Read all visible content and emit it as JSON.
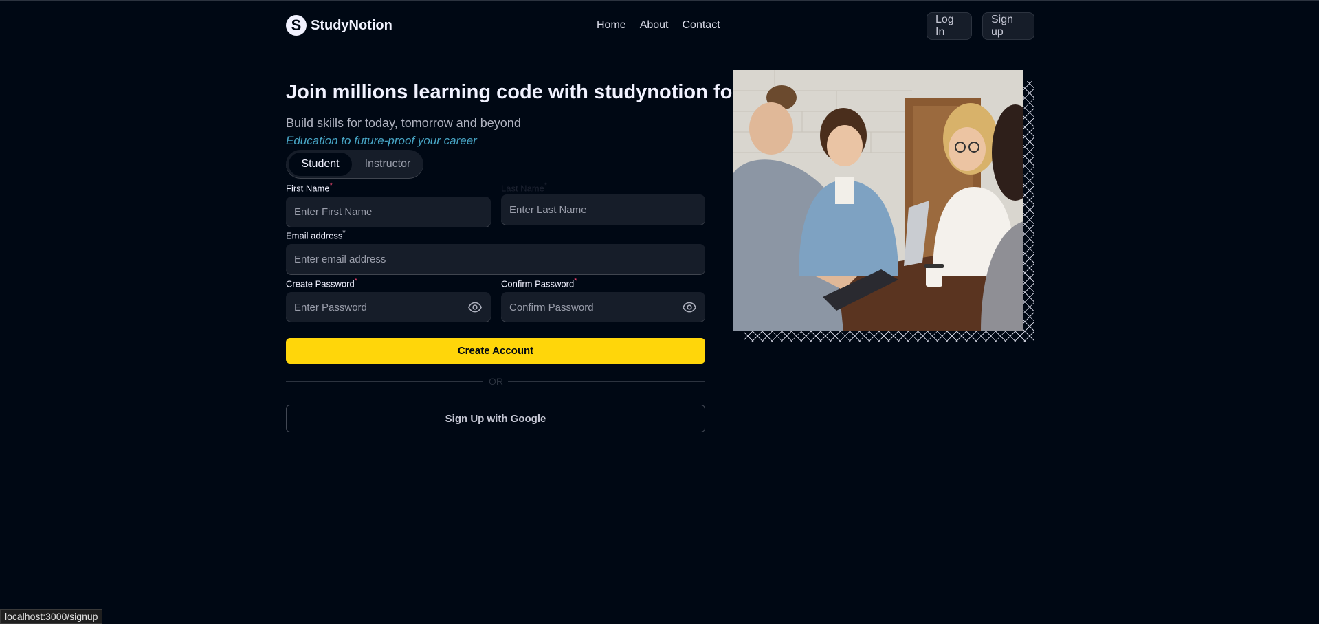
{
  "brand": {
    "name": "StudyNotion",
    "logo_letter": "S"
  },
  "nav": {
    "links": [
      "Home",
      "About",
      "Contact"
    ],
    "login_label": "Log In",
    "signup_label": "Sign up"
  },
  "hero": {
    "heading": "Join millions learning code with studynotion for",
    "subtitle": "Build skills for today, tomorrow and beyond",
    "highlight": "Education to future-proof your career"
  },
  "account_type": {
    "options": [
      "Student",
      "Instructor"
    ],
    "selected": "Student"
  },
  "form": {
    "first_name_label": "First Name",
    "first_name_placeholder": "Enter First Name",
    "last_name_label": "Last Name",
    "last_name_placeholder": "Enter Last Name",
    "email_label": "Email address",
    "email_placeholder": "Enter email address",
    "password_label": "Create Password",
    "password_placeholder": "Enter Password",
    "confirm_label": "Confirm Password",
    "confirm_placeholder": "Confirm Password",
    "required_mark": "*",
    "submit_label": "Create Account",
    "or_text": "OR",
    "google_label": "Sign Up with Google"
  },
  "status_bar": {
    "url": "localhost:3000/signup"
  },
  "colors": {
    "background": "#000814",
    "accent_yellow": "#FFD60A",
    "highlight_blue": "#47A5C5",
    "required_red": "#EF476F",
    "field_bg": "#161D29"
  },
  "icons": {
    "password_toggle": "eye-icon",
    "image_frame": "crosshatch-pattern"
  }
}
